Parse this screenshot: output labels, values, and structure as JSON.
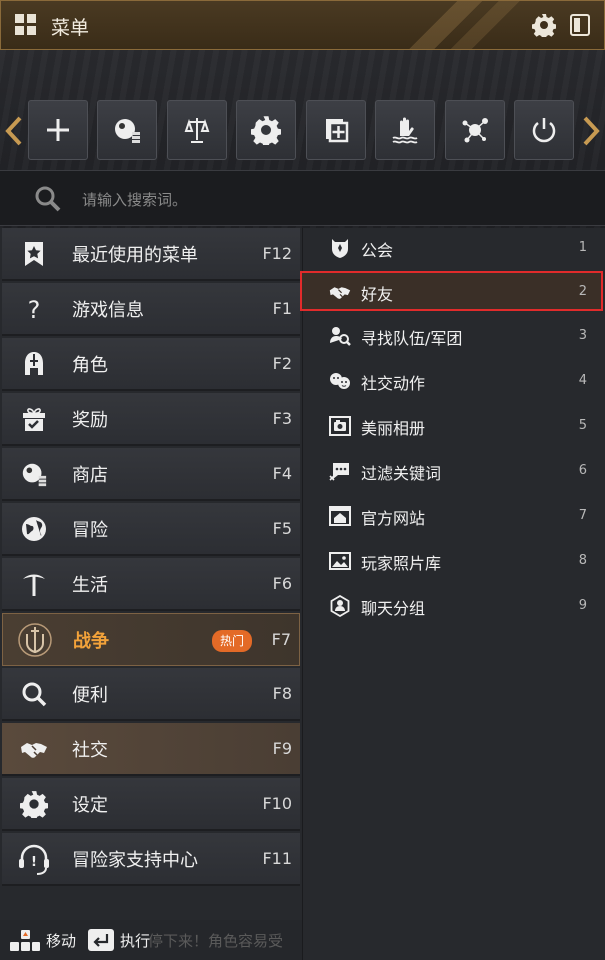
{
  "header": {
    "title": "菜单",
    "icons": [
      "grid-icon",
      "gear-icon",
      "panel-toggle-icon"
    ]
  },
  "toolbar": {
    "buttons": [
      {
        "icon": "plus-icon"
      },
      {
        "icon": "shop-orb-icon"
      },
      {
        "icon": "scales-icon"
      },
      {
        "icon": "gear-icon"
      },
      {
        "icon": "add-frame-icon"
      },
      {
        "icon": "hand-water-icon"
      },
      {
        "icon": "network-node-icon"
      },
      {
        "icon": "power-icon"
      }
    ]
  },
  "search": {
    "placeholder": "请输入搜索词。"
  },
  "menu": {
    "items": [
      {
        "label": "最近使用的菜单",
        "key": "F12",
        "icon": "star-bookmark-icon"
      },
      {
        "label": "游戏信息",
        "key": "F1",
        "icon": "question-icon"
      },
      {
        "label": "角色",
        "key": "F2",
        "icon": "knight-helmet-icon"
      },
      {
        "label": "奖励",
        "key": "F3",
        "icon": "gift-icon"
      },
      {
        "label": "商店",
        "key": "F4",
        "icon": "shop-orb-icon"
      },
      {
        "label": "冒险",
        "key": "F5",
        "icon": "globe-icon"
      },
      {
        "label": "生活",
        "key": "F6",
        "icon": "pickaxe-icon"
      },
      {
        "label": "战争",
        "key": "F7",
        "icon": "sword-shield-icon",
        "badge": "热门"
      },
      {
        "label": "便利",
        "key": "F8",
        "icon": "magnifier-icon"
      },
      {
        "label": "社交",
        "key": "F9",
        "icon": "handshake-icon"
      },
      {
        "label": "设定",
        "key": "F10",
        "icon": "gear-icon"
      },
      {
        "label": "冒险家支持中心",
        "key": "F11",
        "icon": "headset-icon"
      }
    ]
  },
  "submenu": {
    "items": [
      {
        "label": "公会",
        "num": "1",
        "icon": "guild-crest-icon"
      },
      {
        "label": "好友",
        "num": "2",
        "icon": "handshake-icon"
      },
      {
        "label": "寻找队伍/军团",
        "num": "3",
        "icon": "party-search-icon"
      },
      {
        "label": "社交动作",
        "num": "4",
        "icon": "emote-icon"
      },
      {
        "label": "美丽相册",
        "num": "5",
        "icon": "photo-album-icon"
      },
      {
        "label": "过滤关键词",
        "num": "6",
        "icon": "chat-filter-icon"
      },
      {
        "label": "官方网站",
        "num": "7",
        "icon": "home-window-icon"
      },
      {
        "label": "玩家照片库",
        "num": "8",
        "icon": "picture-icon"
      },
      {
        "label": "聊天分组",
        "num": "9",
        "icon": "chat-group-icon"
      }
    ]
  },
  "footer": {
    "move_label": "移动",
    "execute_label": "执行",
    "ghost_text": "停下来！角色容易受"
  },
  "colors": {
    "accent": "#f2a23a",
    "badge": "#e36a27",
    "highlight_border": "#e12b2b",
    "header_bg": "#4a3a22"
  }
}
